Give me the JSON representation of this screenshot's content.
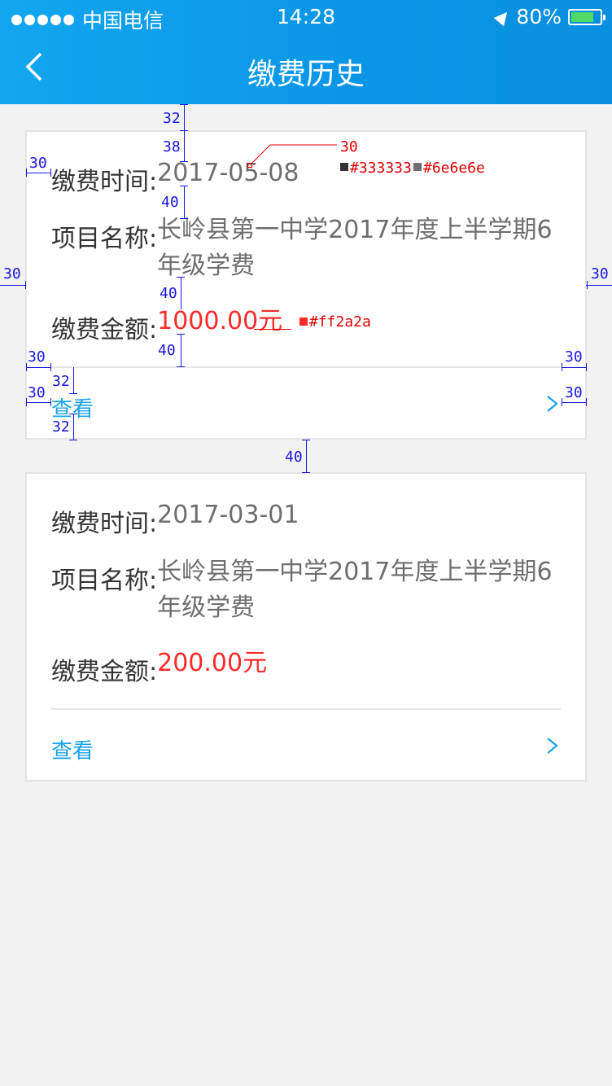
{
  "status_bar": {
    "carrier": "中国电信",
    "time": "14:28",
    "battery": "80%",
    "battery_level": 0.8
  },
  "nav": {
    "title": "缴费历史"
  },
  "labels": {
    "time": "缴费时间:",
    "project": "项目名称:",
    "amount": "缴费金额:",
    "view": "查看"
  },
  "records": [
    {
      "date": "2017-05-08",
      "project_line1": "长岭县第一中学2017年度上半学期6",
      "project_line2": "年级学费",
      "amount": "1000.00元"
    },
    {
      "date": "2017-03-01",
      "project_line1": "长岭县第一中学2017年度上半学期6",
      "project_line2": "年级学费",
      "amount": "200.00元"
    }
  ],
  "annotations": {
    "m32a": "32",
    "m38": "38",
    "m40a": "40",
    "m30a": "30",
    "m40b": "40",
    "m40c": "40",
    "m30l": "30",
    "m30r": "30",
    "m30b": "30",
    "m30c": "30",
    "m32b": "32",
    "m30d": "30",
    "m30e": "30",
    "m32c": "32",
    "m40d": "40",
    "font30": "30",
    "color_text": "#333333",
    "color_value": "#6e6e6e",
    "color_amount": "#ff2a2a"
  },
  "colors": {
    "header": "#0a95e6",
    "text": "#333333",
    "value": "#6e6e6e",
    "amount": "#ff2a2a",
    "link": "#1aa2e8"
  }
}
